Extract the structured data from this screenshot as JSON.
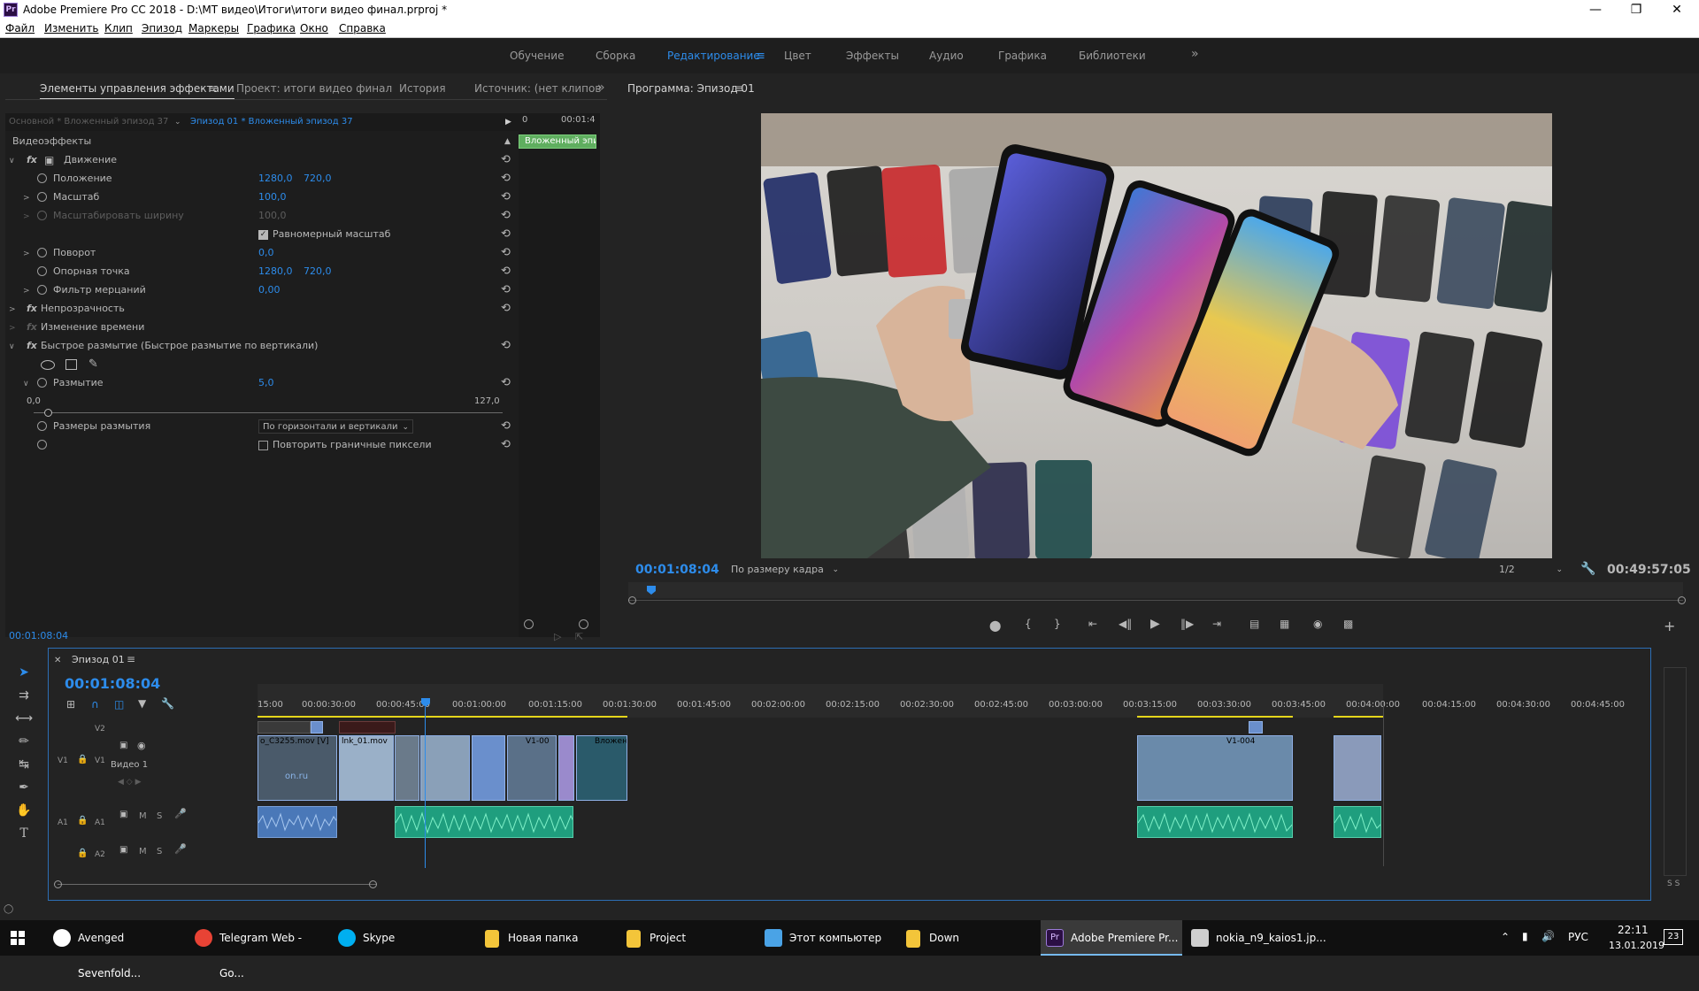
{
  "titlebar": {
    "app_icon": "Pr",
    "title": "Adobe Premiere Pro CC 2018 - D:\\MT видео\\Итоги\\итоги видео финал.prproj *"
  },
  "menu": [
    "Файл",
    "Изменить",
    "Клип",
    "Эпизод",
    "Маркеры",
    "Графика",
    "Окно",
    "Справка"
  ],
  "workspaces": [
    {
      "label": "Обучение"
    },
    {
      "label": "Сборка"
    },
    {
      "label": "Редактирование",
      "active": true
    },
    {
      "label": "Цвет"
    },
    {
      "label": "Эффекты"
    },
    {
      "label": "Аудио"
    },
    {
      "label": "Графика"
    },
    {
      "label": "Библиотеки"
    }
  ],
  "left_tabs": [
    "Элементы управления эффектами",
    "Проект: итоги видео финал",
    "История",
    "Источник: (нет клипов"
  ],
  "effect_controls": {
    "master_label": "Основной * Вложенный эпизод 37",
    "sequence_label": "Эпизод 01 * Вложенный эпизод 37",
    "mini_time_start": "0",
    "mini_time_end": "00:01:4",
    "mini_clip_label": "Вложенный эпи",
    "video_effects": "Видеоэффекты",
    "motion": "Движение",
    "position_label": "Положение",
    "position_x": "1280,0",
    "position_y": "720,0",
    "scale_label": "Масштаб",
    "scale_value": "100,0",
    "scale_width_label": "Масштабировать ширину",
    "scale_width_value": "100,0",
    "uniform_scale": "Равномерный масштаб",
    "rotation_label": "Поворот",
    "rotation_value": "0,0",
    "anchor_label": "Опорная точка",
    "anchor_x": "1280,0",
    "anchor_y": "720,0",
    "flicker_label": "Фильтр мерцаний",
    "flicker_value": "0,00",
    "opacity": "Непрозрачность",
    "time_remap": "Изменение времени",
    "fast_blur": "Быстрое размытие (Быстрое размытие по вертикали)",
    "blur_label": "Размытие",
    "blur_value": "5,0",
    "blur_min": "0,0",
    "blur_max": "127,0",
    "blur_dims_label": "Размеры размытия",
    "blur_dims_value": "По горизонтали и вертикали",
    "repeat_edge": "Повторить граничные пиксели",
    "timecode": "00:01:08:04"
  },
  "program": {
    "title": "Программа: Эпизод 01",
    "timecode": "00:01:08:04",
    "fit": "По размеру кадра",
    "resolution": "1/2",
    "duration": "00:49:57:05"
  },
  "timeline": {
    "tab": "Эпизод 01",
    "timecode": "00:01:08:04",
    "ruler": [
      "15:00",
      "00:00:30:00",
      "00:00:45:00",
      "00:01:00:00",
      "00:01:15:00",
      "00:01:30:00",
      "00:01:45:00",
      "00:02:00:00",
      "00:02:15:00",
      "00:02:30:00",
      "00:02:45:00",
      "00:03:00:00",
      "00:03:15:00",
      "00:03:30:00",
      "00:03:45:00",
      "00:04:00:00",
      "00:04:15:00",
      "00:04:30:00",
      "00:04:45:00"
    ],
    "tracks": {
      "v2": "V2",
      "v1": "V1",
      "v1_src": "V1",
      "video1": "Видео 1",
      "a1": "A1",
      "a1_src": "A1",
      "a2": "A2"
    },
    "clip_labels": [
      "o_C3255.mov [V]",
      "lnk_01.mov",
      "V1-00",
      "Вложенны",
      "V1-004"
    ],
    "overlay_text": "on.ru"
  },
  "taskbar": {
    "items": [
      {
        "label": "Avenged Sevenfold...",
        "icon": "wolf-icon",
        "color": "#ffffff"
      },
      {
        "label": "Telegram Web - Go...",
        "icon": "chrome-icon",
        "color": "#e84335"
      },
      {
        "label": "Skype",
        "icon": "skype-icon",
        "color": "#00aff0"
      },
      {
        "label": "Новая папка",
        "icon": "folder-icon",
        "color": "#f3c53a"
      },
      {
        "label": "Project",
        "icon": "folder-icon",
        "color": "#f3c53a"
      },
      {
        "label": "Этот компьютер",
        "icon": "computer-icon",
        "color": "#4aa3e6"
      },
      {
        "label": "Down",
        "icon": "folder-icon",
        "color": "#f3c53a"
      },
      {
        "label": "Adobe Premiere Pr...",
        "icon": "premiere-icon",
        "color": "#2b0f44",
        "active": true
      },
      {
        "label": "nokia_n9_kaios1.jp...",
        "icon": "photo-icon",
        "color": "#cfcfcf"
      }
    ],
    "language": "РУС",
    "time": "22:11",
    "date": "13.01.2019",
    "notifications": "23"
  },
  "colors": {
    "accent": "#2d8ceb",
    "video_clip": "#6a8fcc",
    "audio_clip": "#1f9e7e",
    "work_area": "#e4d51b"
  }
}
